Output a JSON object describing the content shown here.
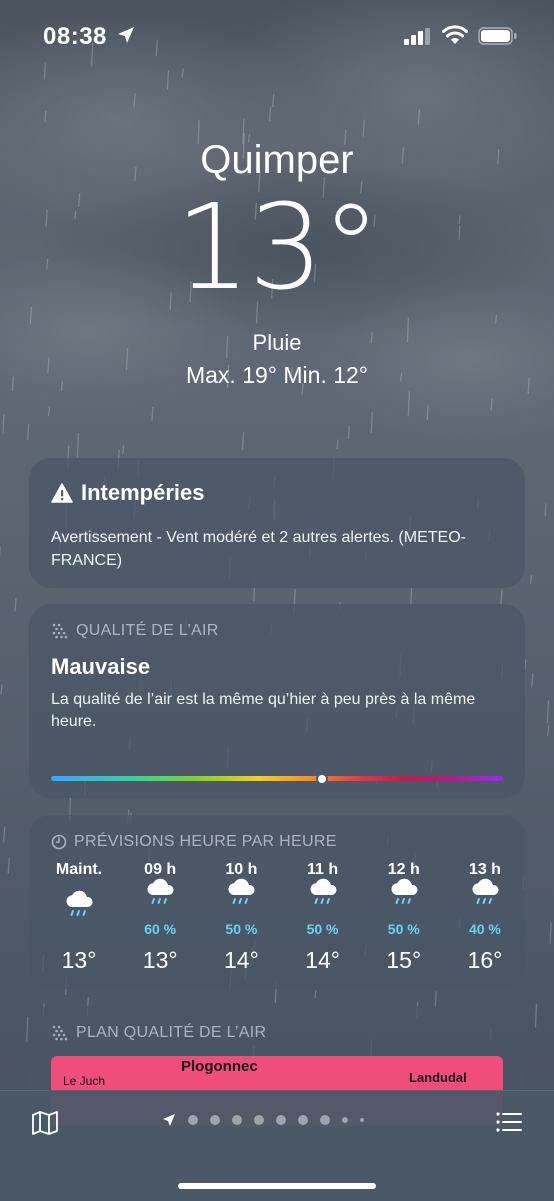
{
  "status_bar": {
    "time": "08:38"
  },
  "weather": {
    "city": "Quimper",
    "temperature": "13°",
    "condition": "Pluie",
    "hi_lo": "Max. 19°  Min. 12°"
  },
  "alert_card": {
    "title": "Intempéries",
    "body": "Avertissement - Vent modéré et 2 autres alertes. (METEO-FRANCE)"
  },
  "air_quality_card": {
    "header": "QUALITÉ DE L’AIR",
    "level": "Mauvaise",
    "description": "La qualité de l’air est la même qu’hier à peu près à la même heure.",
    "level_fraction": 0.6
  },
  "hourly_card": {
    "header": "PRÉVISIONS HEURE PAR HEURE",
    "hours": [
      {
        "label": "Maint.",
        "precip": "",
        "temp": "13°",
        "icon": "rain-cloud-icon"
      },
      {
        "label": "09 h",
        "precip": "60 %",
        "temp": "13°",
        "icon": "rain-cloud-icon"
      },
      {
        "label": "10 h",
        "precip": "50 %",
        "temp": "14°",
        "icon": "rain-cloud-icon"
      },
      {
        "label": "11 h",
        "precip": "50 %",
        "temp": "14°",
        "icon": "rain-cloud-icon"
      },
      {
        "label": "12 h",
        "precip": "50 %",
        "temp": "15°",
        "icon": "rain-cloud-icon"
      },
      {
        "label": "13 h",
        "precip": "40 %",
        "temp": "16°",
        "icon": "rain-cloud-icon"
      }
    ]
  },
  "air_map_card": {
    "header": "PLAN QUALITÉ DE L’AIR",
    "places": [
      "Plogonnec",
      "Le Juch",
      "Landudal"
    ]
  },
  "bottom_bar": {
    "pages": 9,
    "current_page": 0
  },
  "colors": {
    "precip": "#6ccff6",
    "map_fill": "#ef4d7a"
  }
}
